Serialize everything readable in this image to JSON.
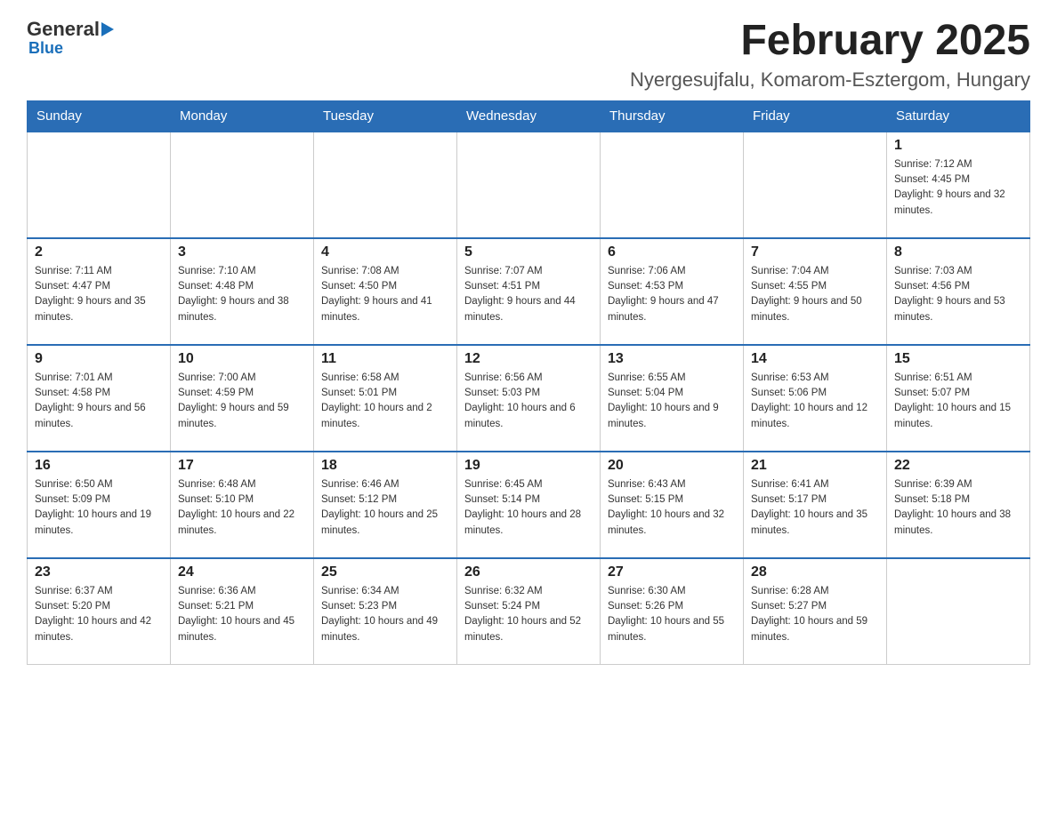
{
  "logo": {
    "general": "General",
    "blue": "Blue",
    "sub": "Blue"
  },
  "header": {
    "month_title": "February 2025",
    "location": "Nyergesujfalu, Komarom-Esztergom, Hungary"
  },
  "weekdays": [
    "Sunday",
    "Monday",
    "Tuesday",
    "Wednesday",
    "Thursday",
    "Friday",
    "Saturday"
  ],
  "weeks": [
    [
      {
        "day": "",
        "info": ""
      },
      {
        "day": "",
        "info": ""
      },
      {
        "day": "",
        "info": ""
      },
      {
        "day": "",
        "info": ""
      },
      {
        "day": "",
        "info": ""
      },
      {
        "day": "",
        "info": ""
      },
      {
        "day": "1",
        "info": "Sunrise: 7:12 AM\nSunset: 4:45 PM\nDaylight: 9 hours and 32 minutes."
      }
    ],
    [
      {
        "day": "2",
        "info": "Sunrise: 7:11 AM\nSunset: 4:47 PM\nDaylight: 9 hours and 35 minutes."
      },
      {
        "day": "3",
        "info": "Sunrise: 7:10 AM\nSunset: 4:48 PM\nDaylight: 9 hours and 38 minutes."
      },
      {
        "day": "4",
        "info": "Sunrise: 7:08 AM\nSunset: 4:50 PM\nDaylight: 9 hours and 41 minutes."
      },
      {
        "day": "5",
        "info": "Sunrise: 7:07 AM\nSunset: 4:51 PM\nDaylight: 9 hours and 44 minutes."
      },
      {
        "day": "6",
        "info": "Sunrise: 7:06 AM\nSunset: 4:53 PM\nDaylight: 9 hours and 47 minutes."
      },
      {
        "day": "7",
        "info": "Sunrise: 7:04 AM\nSunset: 4:55 PM\nDaylight: 9 hours and 50 minutes."
      },
      {
        "day": "8",
        "info": "Sunrise: 7:03 AM\nSunset: 4:56 PM\nDaylight: 9 hours and 53 minutes."
      }
    ],
    [
      {
        "day": "9",
        "info": "Sunrise: 7:01 AM\nSunset: 4:58 PM\nDaylight: 9 hours and 56 minutes."
      },
      {
        "day": "10",
        "info": "Sunrise: 7:00 AM\nSunset: 4:59 PM\nDaylight: 9 hours and 59 minutes."
      },
      {
        "day": "11",
        "info": "Sunrise: 6:58 AM\nSunset: 5:01 PM\nDaylight: 10 hours and 2 minutes."
      },
      {
        "day": "12",
        "info": "Sunrise: 6:56 AM\nSunset: 5:03 PM\nDaylight: 10 hours and 6 minutes."
      },
      {
        "day": "13",
        "info": "Sunrise: 6:55 AM\nSunset: 5:04 PM\nDaylight: 10 hours and 9 minutes."
      },
      {
        "day": "14",
        "info": "Sunrise: 6:53 AM\nSunset: 5:06 PM\nDaylight: 10 hours and 12 minutes."
      },
      {
        "day": "15",
        "info": "Sunrise: 6:51 AM\nSunset: 5:07 PM\nDaylight: 10 hours and 15 minutes."
      }
    ],
    [
      {
        "day": "16",
        "info": "Sunrise: 6:50 AM\nSunset: 5:09 PM\nDaylight: 10 hours and 19 minutes."
      },
      {
        "day": "17",
        "info": "Sunrise: 6:48 AM\nSunset: 5:10 PM\nDaylight: 10 hours and 22 minutes."
      },
      {
        "day": "18",
        "info": "Sunrise: 6:46 AM\nSunset: 5:12 PM\nDaylight: 10 hours and 25 minutes."
      },
      {
        "day": "19",
        "info": "Sunrise: 6:45 AM\nSunset: 5:14 PM\nDaylight: 10 hours and 28 minutes."
      },
      {
        "day": "20",
        "info": "Sunrise: 6:43 AM\nSunset: 5:15 PM\nDaylight: 10 hours and 32 minutes."
      },
      {
        "day": "21",
        "info": "Sunrise: 6:41 AM\nSunset: 5:17 PM\nDaylight: 10 hours and 35 minutes."
      },
      {
        "day": "22",
        "info": "Sunrise: 6:39 AM\nSunset: 5:18 PM\nDaylight: 10 hours and 38 minutes."
      }
    ],
    [
      {
        "day": "23",
        "info": "Sunrise: 6:37 AM\nSunset: 5:20 PM\nDaylight: 10 hours and 42 minutes."
      },
      {
        "day": "24",
        "info": "Sunrise: 6:36 AM\nSunset: 5:21 PM\nDaylight: 10 hours and 45 minutes."
      },
      {
        "day": "25",
        "info": "Sunrise: 6:34 AM\nSunset: 5:23 PM\nDaylight: 10 hours and 49 minutes."
      },
      {
        "day": "26",
        "info": "Sunrise: 6:32 AM\nSunset: 5:24 PM\nDaylight: 10 hours and 52 minutes."
      },
      {
        "day": "27",
        "info": "Sunrise: 6:30 AM\nSunset: 5:26 PM\nDaylight: 10 hours and 55 minutes."
      },
      {
        "day": "28",
        "info": "Sunrise: 6:28 AM\nSunset: 5:27 PM\nDaylight: 10 hours and 59 minutes."
      },
      {
        "day": "",
        "info": ""
      }
    ]
  ]
}
